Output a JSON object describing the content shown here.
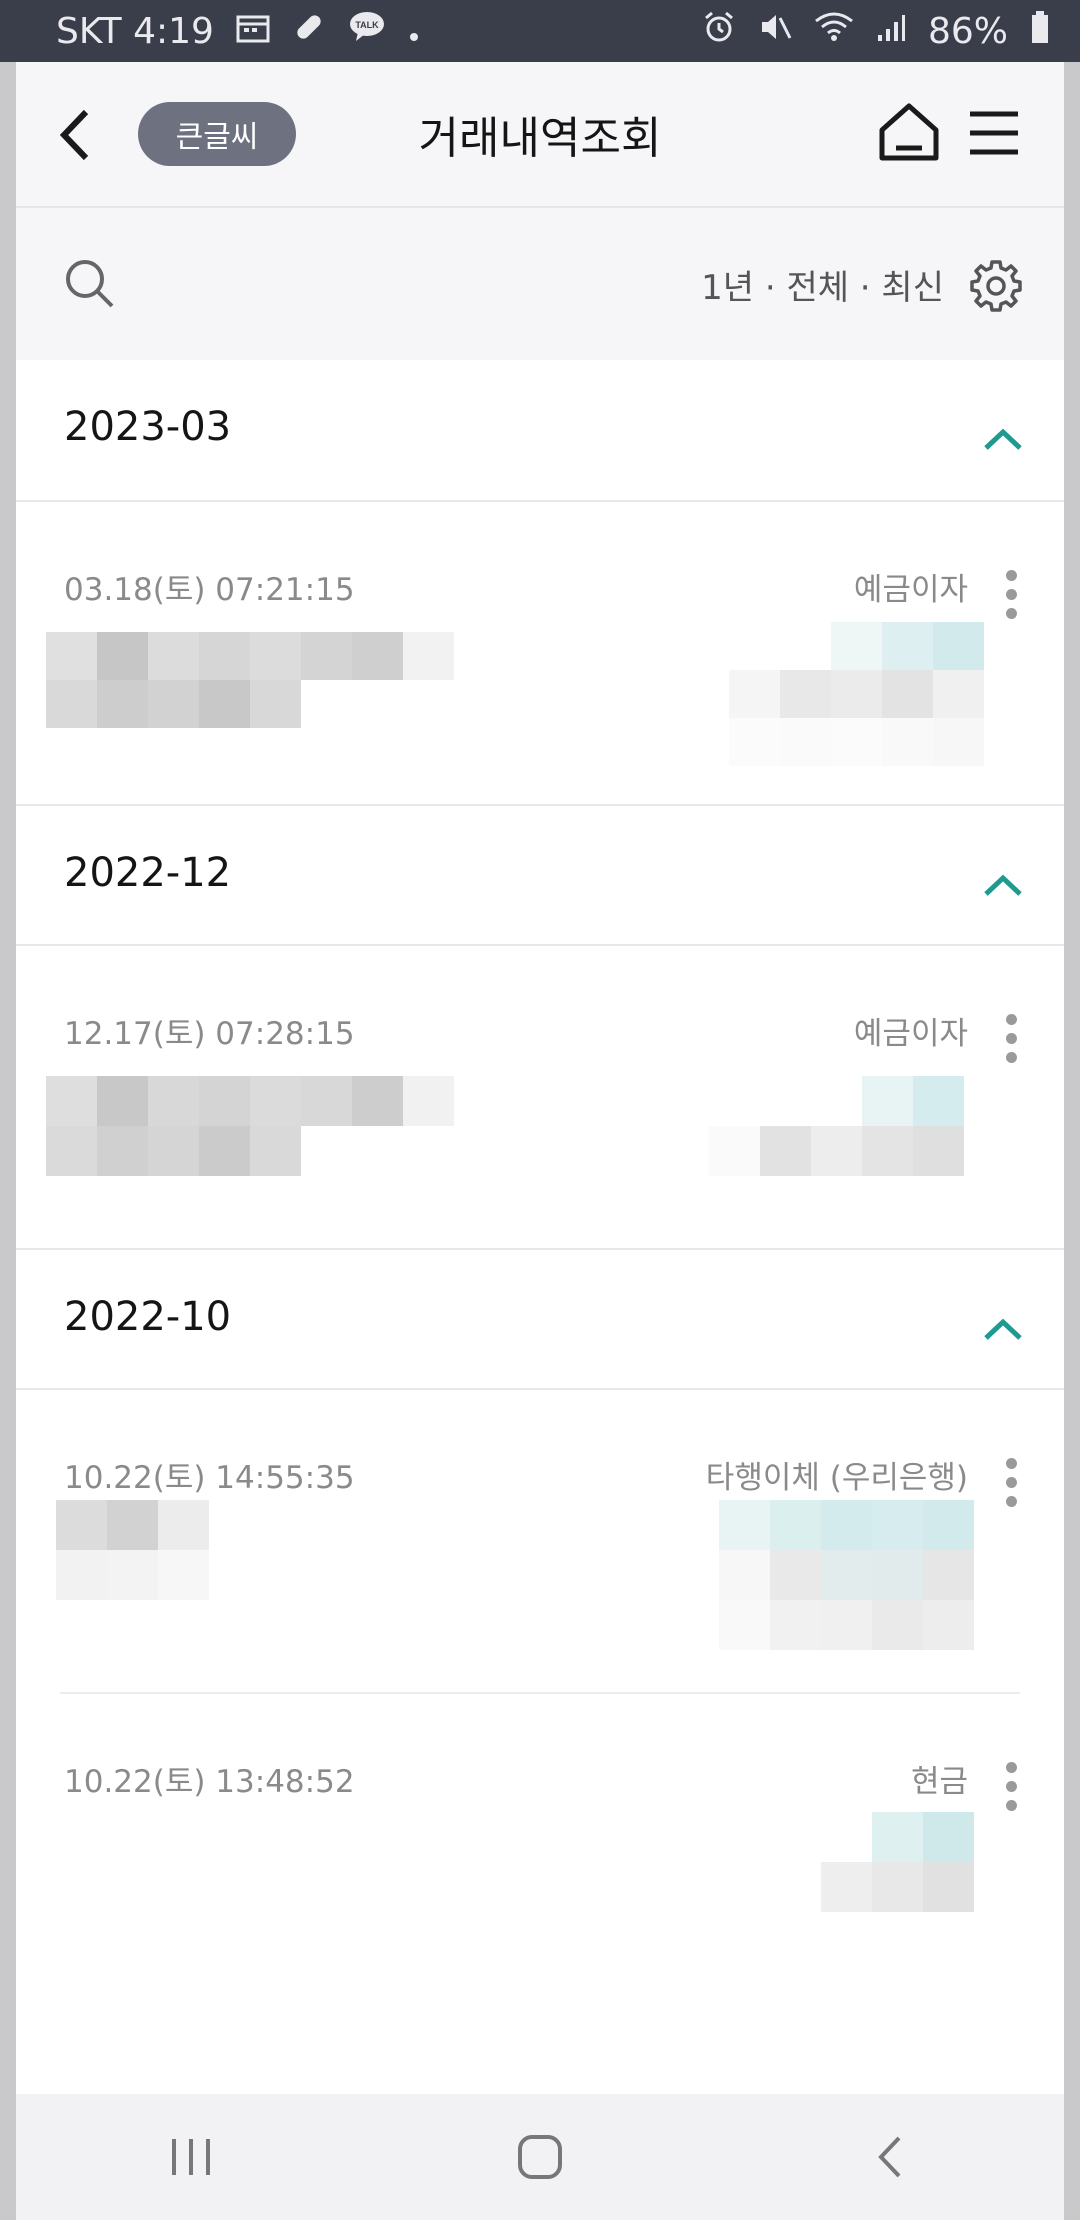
{
  "status_bar": {
    "carrier_time": "SKT 4:19",
    "battery": "86%",
    "left_icons": [
      "calendar-icon",
      "pill-icon",
      "kakaotalk-icon",
      "dot-icon"
    ],
    "right_icons": [
      "alarm-icon",
      "mute-icon",
      "wifi-icon",
      "signal-icon",
      "battery-icon"
    ]
  },
  "header": {
    "big_font_label": "큰글씨",
    "title": "거래내역조회"
  },
  "filter": {
    "summary": "1년 · 전체 · 최신"
  },
  "months": [
    {
      "label": "2023-03",
      "transactions": [
        {
          "datetime": "03.18(토) 07:21:15",
          "kind": "예금이자"
        }
      ]
    },
    {
      "label": "2022-12",
      "transactions": [
        {
          "datetime": "12.17(토) 07:28:15",
          "kind": "예금이자"
        }
      ]
    },
    {
      "label": "2022-10",
      "transactions": [
        {
          "datetime": "10.22(토) 14:55:35",
          "kind": "타행이체 (우리은행)"
        },
        {
          "datetime": "10.22(토) 13:48:52",
          "kind": "현금"
        }
      ]
    }
  ],
  "colors": {
    "accent": "#1e9a91",
    "chip_bg": "#6e7180",
    "status_bar_bg": "#3a3e4a"
  }
}
